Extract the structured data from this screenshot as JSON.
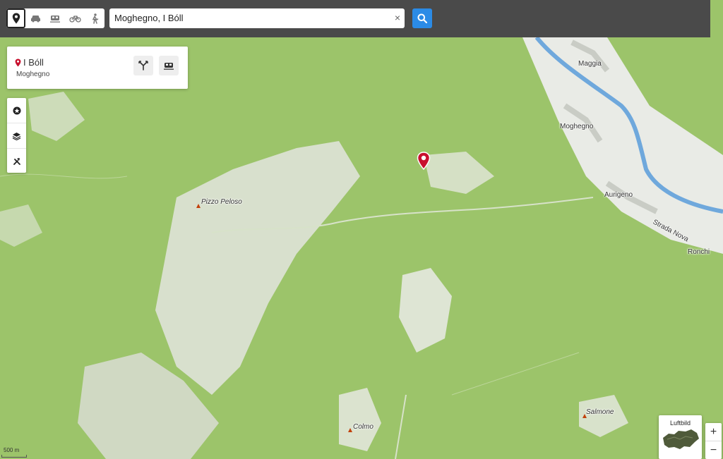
{
  "toolbar": {
    "modes": [
      {
        "icon": "location-pin-icon",
        "active": true
      },
      {
        "icon": "car-icon",
        "active": false
      },
      {
        "icon": "train-icon",
        "active": false
      },
      {
        "icon": "bicycle-icon",
        "active": false
      },
      {
        "icon": "pedestrian-icon",
        "active": false
      }
    ],
    "search_value": "Moghegno, I Bóll",
    "clear_label": "×",
    "search_icon": "magnifier-icon"
  },
  "place_card": {
    "title": "I Bóll",
    "subtitle": "Moghegno",
    "route_icon": "route-icon",
    "transit_icon": "train-icon"
  },
  "side_tools": [
    "star-icon",
    "layers-icon",
    "tools-icon"
  ],
  "map": {
    "labels": {
      "maggia": "Maggia",
      "moghegno": "Moghegno",
      "aurigeno": "Aurigeno",
      "strada_nova": "Strada Nova",
      "ronchi": "Ronchi",
      "pizzo_peloso": "Pizzo Peloso",
      "colmo": "Colmo",
      "salmone": "Salmone"
    },
    "scale_label": "500 m",
    "colors": {
      "forest": "#9cc46a",
      "open": "#e8ece2",
      "river": "#6fa8dc",
      "peak": "#c2410c",
      "marker": "#c8102e"
    }
  },
  "aerial": {
    "label": "Luftbild"
  },
  "zoom": {
    "in_label": "+",
    "out_label": "−"
  }
}
